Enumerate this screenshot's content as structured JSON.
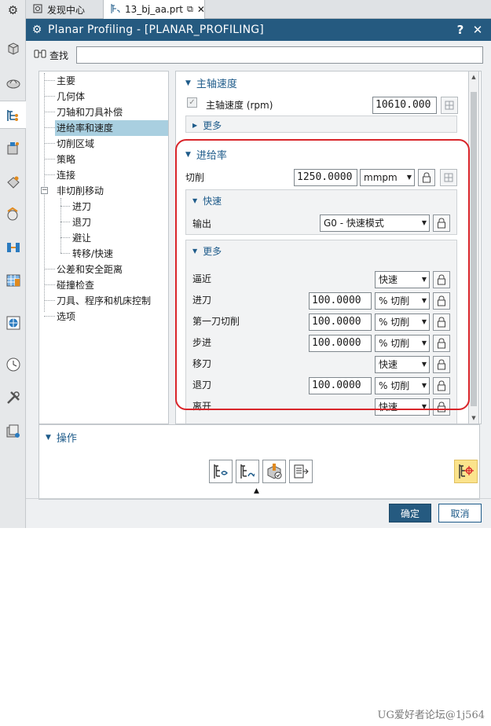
{
  "tabs": [
    {
      "label": "发现中心",
      "icon": "discovery-icon"
    },
    {
      "label": "13_bj_aa.prt",
      "icon": "part-file-icon"
    }
  ],
  "dialog": {
    "title": "Planar Profiling - [PLANAR_PROFILING]",
    "help_label": "?",
    "close_label": "✕"
  },
  "find": {
    "label": "查找",
    "value": ""
  },
  "tree": {
    "items": [
      "主要",
      "几何体",
      "刀轴和刀具补偿",
      "进给率和速度",
      "切削区域",
      "策略",
      "连接",
      "非切削移动",
      "进刀",
      "退刀",
      "避让",
      "转移/快速",
      "公差和安全距离",
      "碰撞检查",
      "刀具、程序和机床控制",
      "选项"
    ],
    "selected": "进给率和速度"
  },
  "spindle": {
    "title": "主轴速度",
    "label": "主轴速度 (rpm)",
    "value": "10610.000",
    "checked": true,
    "more_label": "更多"
  },
  "feed": {
    "title": "进给率",
    "cut_label": "切削",
    "cut_value": "1250.0000",
    "cut_unit": "mmpm",
    "rapid": {
      "title": "快速",
      "output_label": "输出",
      "output_value": "G0 - 快速模式"
    },
    "more": {
      "title": "更多",
      "rows": [
        {
          "label": "逼近",
          "value": "",
          "unit": "快速"
        },
        {
          "label": "进刀",
          "value": "100.0000",
          "unit": "% 切削"
        },
        {
          "label": "第一刀切削",
          "value": "100.0000",
          "unit": "% 切削"
        },
        {
          "label": "步进",
          "value": "100.0000",
          "unit": "% 切削"
        },
        {
          "label": "移刀",
          "value": "",
          "unit": "快速"
        },
        {
          "label": "退刀",
          "value": "100.0000",
          "unit": "% 切削"
        },
        {
          "label": "离开",
          "value": "",
          "unit": "快速"
        }
      ]
    }
  },
  "ops": {
    "title": "操作"
  },
  "buttons": {
    "ok": "确定",
    "cancel": "取消"
  },
  "watermark": "UG爱好者论坛@1j564",
  "colors": {
    "title_bar": "#255a80",
    "accent": "#1e5b8a",
    "highlight_box": "#d9252a",
    "selection": "#a9cfe0"
  }
}
